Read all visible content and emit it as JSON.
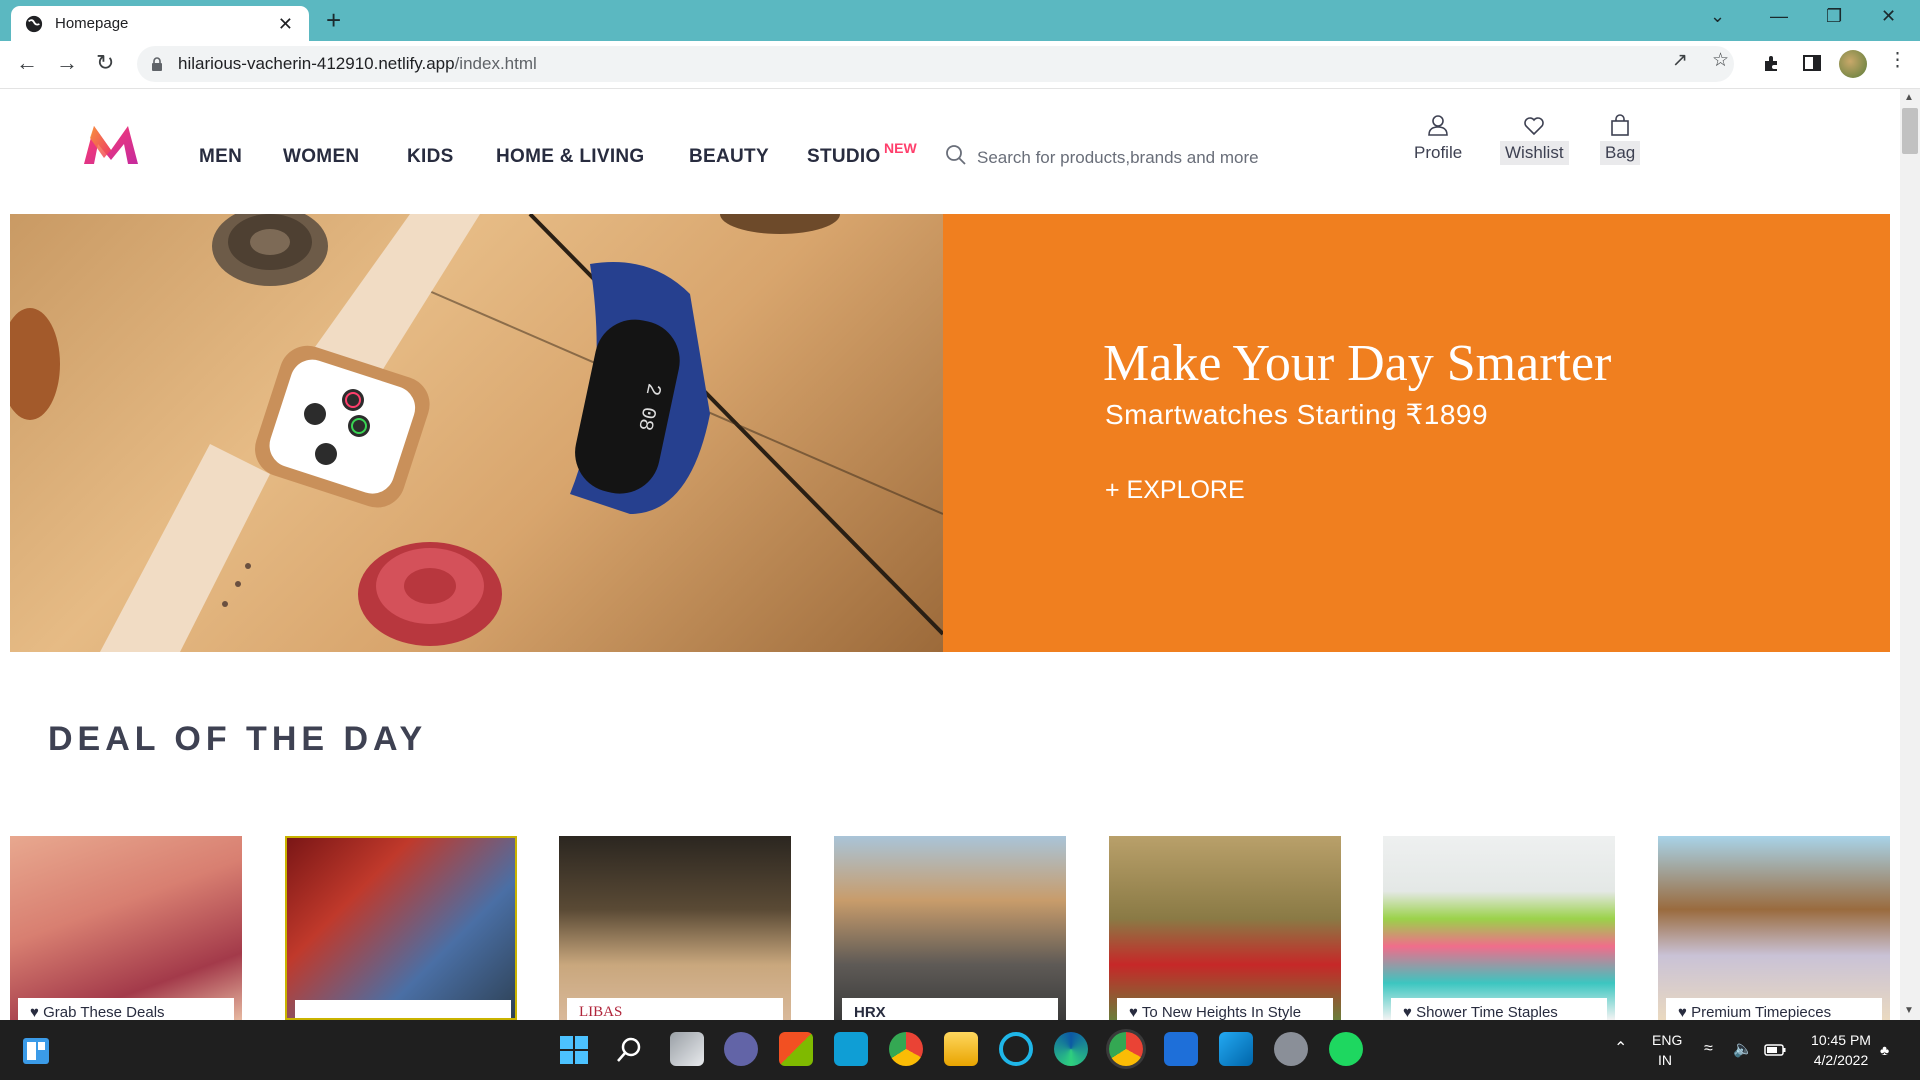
{
  "browser": {
    "tab_title": "Homepage",
    "url_host": "hilarious-vacherin-412910.netlify.app",
    "url_path": "/index.html",
    "tab_close": "✕",
    "new_tab": "+"
  },
  "header": {
    "nav": [
      "MEN",
      "WOMEN",
      "KIDS",
      "HOME & LIVING",
      "BEAUTY",
      "STUDIO"
    ],
    "nav_badge": "NEW",
    "search_placeholder": "Search for products,brands and more",
    "actions": {
      "profile": "Profile",
      "wishlist": "Wishlist",
      "bag": "Bag"
    }
  },
  "banner": {
    "heading": "Make Your Day Smarter",
    "subheading": "Smartwatches Starting ₹1899",
    "cta": "+ EXPLORE",
    "band_display": "2 08"
  },
  "deals": {
    "title": "DEAL OF THE DAY",
    "cards": [
      {
        "caption": "Grab These Deals"
      },
      {
        "caption": ""
      },
      {
        "caption": "LIBAS"
      },
      {
        "caption": "HRX"
      },
      {
        "caption": "To New Heights In Style"
      },
      {
        "caption": "Shower Time Staples"
      },
      {
        "caption": "Premium Timepieces"
      }
    ]
  },
  "taskbar": {
    "language": "ENG",
    "region": "IN",
    "time": "10:45 PM",
    "date": "4/2/2022"
  },
  "colors": {
    "titlebar": "#5bb8c1",
    "banner_orange": "#f07f1f",
    "brand_pink": "#ff3f6c"
  }
}
